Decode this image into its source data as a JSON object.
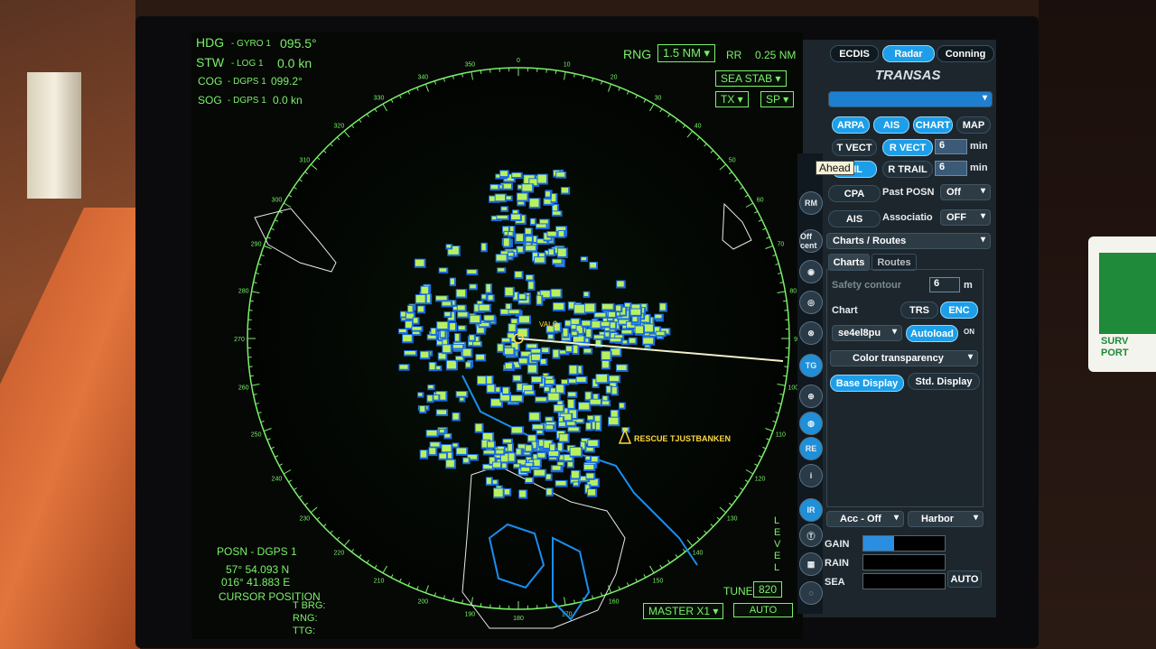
{
  "header": {
    "hdg_label": "HDG",
    "hdg_src": "- GYRO 1",
    "hdg_val": "095.5°",
    "stw_label": "STW",
    "stw_src": "- LOG 1",
    "stw_val": "0.0 kn",
    "cog_label": "COG",
    "cog_src": "- DGPS 1",
    "cog_val": "099.2°",
    "sog_label": "SOG",
    "sog_src": "- DGPS 1",
    "sog_val": "0.0 kn"
  },
  "range": {
    "rng_label": "RNG",
    "rng_value": "1.5 NM",
    "rr_label": "RR",
    "rr_value": "0.25 NM"
  },
  "modes": {
    "sea_stab": "SEA STAB",
    "tx": "TX",
    "sp": "SP"
  },
  "targets": {
    "rescue_label": "RESCUE TJUSTBANKEN",
    "own_label": "VALÖ"
  },
  "tooltip": "Ahead",
  "bearing_scale": [
    "0",
    "10",
    "20",
    "30",
    "40",
    "50",
    "60",
    "70",
    "80",
    "90",
    "100",
    "110",
    "120",
    "130",
    "140",
    "150",
    "160",
    "170",
    "180",
    "190",
    "200",
    "210",
    "220",
    "230",
    "240",
    "250",
    "260",
    "270",
    "280",
    "290",
    "300",
    "310",
    "320",
    "330",
    "340",
    "350"
  ],
  "position": {
    "posn_label": "POSN - DGPS 1",
    "lat": "57° 54.093 N",
    "lon": "016° 41.883 E",
    "cursor_label": "CURSOR POSITION",
    "tbrg": "T BRG:",
    "rng": "RNG:",
    "ttg": "TTG:"
  },
  "bottom": {
    "master": "MASTER X1",
    "tune_label": "TUNE",
    "tune_value": "820",
    "auto": "AUTO",
    "level": [
      "L",
      "E",
      "V",
      "E",
      "L"
    ]
  },
  "panel": {
    "tabs": [
      "ECDIS",
      "Radar",
      "Conning"
    ],
    "brand": "TRANSAS",
    "layers": [
      "ARPA",
      "AIS",
      "CHART",
      "MAP"
    ],
    "tvect": "T VECT",
    "rvect": "R VECT",
    "vect_val": "6",
    "vect_unit": "min",
    "trail": "AIL",
    "rtrail": "R TRAIL",
    "trail_val": "6",
    "trail_unit": "min",
    "cpa": "CPA",
    "past_posn": "Past POSN",
    "past_posn_val": "Off",
    "ais": "AIS",
    "association": "Associatio",
    "association_val": "OFF",
    "charts_routes": "Charts / Routes",
    "subtabs": [
      "Charts",
      "Routes"
    ],
    "safety_contour": "Safety contour",
    "safety_val": "6",
    "safety_unit": "m",
    "chart_label": "Chart",
    "trs": "TRS",
    "enc": "ENC",
    "chart_name": "se4el8pu",
    "autoload": "Autoload",
    "autoload_state": "ON",
    "color_transparency": "Color transparency",
    "base_display": "Base Display",
    "std_display": "Std. Display",
    "acc": "Acc - Off",
    "harbor": "Harbor",
    "gain": "GAIN",
    "rain": "RAIN",
    "sea": "SEA",
    "auto_btn": "AUTO",
    "gain_level": 0.38
  },
  "sidebar": [
    "RM",
    "Off cent",
    "◉",
    "◎",
    "⊗",
    "TG",
    "⊕",
    "◍",
    "RE",
    "i",
    "IR",
    "Ⓣ",
    "▦",
    "◌"
  ],
  "colors": {
    "radar_green": "#7bf06a",
    "echo_blue": "#1a6be0",
    "accent": "#1d9ee8"
  }
}
